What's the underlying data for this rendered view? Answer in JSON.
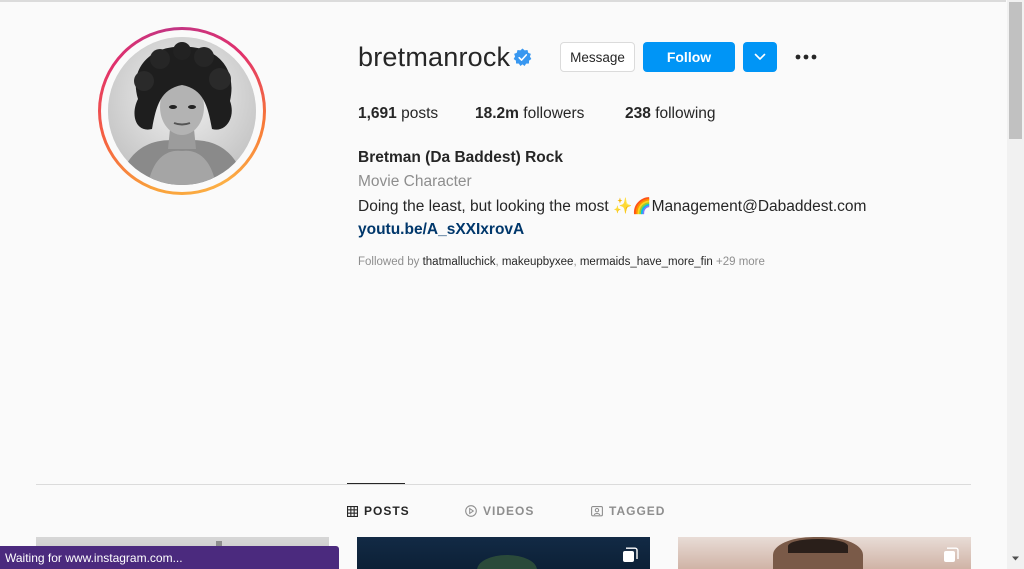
{
  "profile": {
    "username": "bretmanrock",
    "verified": true,
    "buttons": {
      "message": "Message",
      "follow": "Follow"
    },
    "stats": {
      "posts_count": "1,691",
      "posts_label": "posts",
      "followers_count": "18.2m",
      "followers_label": "followers",
      "following_count": "238",
      "following_label": "following"
    },
    "bio": {
      "name": "Bretman (Da Baddest) Rock",
      "category": "Movie Character",
      "text": "Doing the least, but looking the most ✨🌈Management@Dabaddest.com",
      "link": "youtu.be/A_sXXIxrovA"
    },
    "followed_by": {
      "prefix": "Followed by",
      "account_1": "thatmalluchick",
      "account_2": "makeupbyxee",
      "account_3": "mermaids_have_more_fin",
      "more": "+29 more"
    }
  },
  "tabs": [
    {
      "label": "POSTS",
      "icon": "grid-icon",
      "active": true
    },
    {
      "label": "VIDEOS",
      "icon": "play-circle-icon",
      "active": false
    },
    {
      "label": "TAGGED",
      "icon": "tag-portrait-icon",
      "active": false
    }
  ],
  "status_bar": {
    "text": "Waiting for www.instagram.com..."
  },
  "colors": {
    "follow_blue": "#0095f6",
    "verified_blue": "#3897f0",
    "link_blue": "#00376b",
    "status_purple": "#4b2a7e"
  }
}
